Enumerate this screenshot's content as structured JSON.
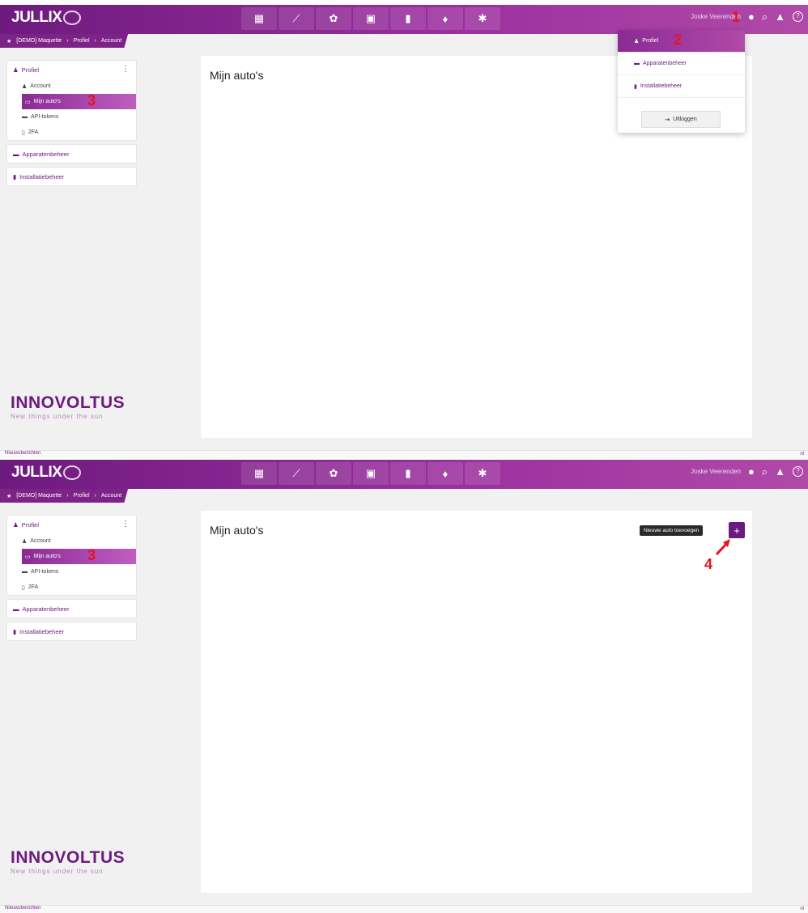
{
  "app": {
    "logo": "JULLIX",
    "username": "Joske Veerenden",
    "breadcrumb": [
      "[DEMO] Maquette",
      "Profiel",
      "Account"
    ],
    "nav_icons": [
      "dashboard-icon",
      "chart-icon",
      "brain-icon",
      "camera-icon",
      "battery-icon",
      "plug-icon",
      "settings-icon"
    ]
  },
  "sidebar": {
    "profile_label": "Profiel",
    "items": [
      {
        "label": "Account"
      },
      {
        "label": "Mijn auto's"
      },
      {
        "label": "API-tokens"
      },
      {
        "label": "2FA"
      }
    ],
    "device_mgmt": "Apparatenbeheer",
    "install_mgmt": "Installatiebeheer"
  },
  "main": {
    "title": "Mijn auto's"
  },
  "brand": {
    "name": "INNOVOLTUS",
    "tagline": "New things under the sun"
  },
  "footer": {
    "left": "Nieuwsberichten",
    "right": "nl"
  },
  "dropdown": {
    "profile": "Profiel",
    "devices": "Apparatenbeheer",
    "installations": "Installatiebeheer",
    "logout": "Uitloggen"
  },
  "add_car": {
    "tooltip": "Nieuwe auto toevoegen",
    "button": "+"
  },
  "markers": {
    "m1": "1",
    "m2": "2",
    "m3": "3",
    "m4": "4"
  },
  "colors": {
    "brand_purple": "#6d1a7e",
    "accent_pink": "#b04aa8",
    "marker_red": "#e8131f"
  }
}
